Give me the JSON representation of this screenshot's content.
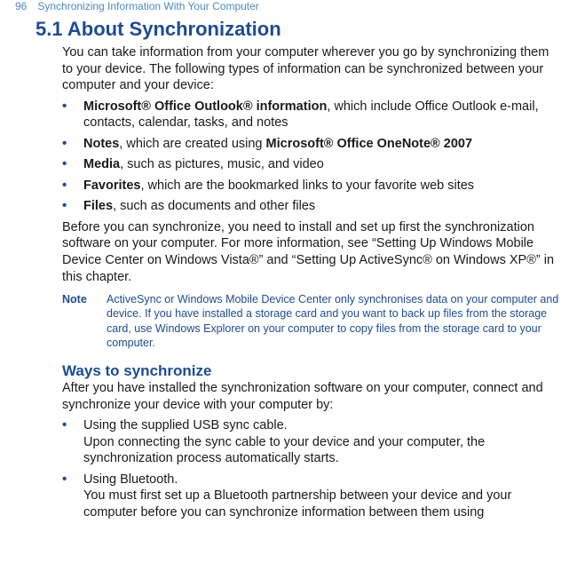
{
  "header": {
    "page_number": "96",
    "running_title": "Synchronizing Information With Your Computer"
  },
  "section": {
    "number": "5.1",
    "title": "About Synchronization"
  },
  "intro": "You can take information from your computer wherever you go by synchronizing them to your device. The following types of information can be synchronized between your computer and your device:",
  "bullets": [
    {
      "b": "Microsoft® Office Outlook® information",
      "after": ", which include Office Outlook e-mail, contacts, calendar, tasks, and notes"
    },
    {
      "b": "Notes",
      "mid": ", which are created using ",
      "b2": "Microsoft® Office OneNote® 2007"
    },
    {
      "b": "Media",
      "after": ", such as pictures, music, and video"
    },
    {
      "b": "Favorites",
      "after": ", which are the bookmarked links to your favorite web sites"
    },
    {
      "b": "Files",
      "after": ", such as documents and other files"
    }
  ],
  "para2": "Before you can synchronize, you need to install and set up first the synchronization software on your computer. For more information, see “Setting Up Windows Mobile Device Center on Windows Vista®” and “Setting Up ActiveSync® on Windows XP®” in this chapter.",
  "note": {
    "label": "Note",
    "text": "ActiveSync or Windows Mobile Device Center only synchronises data on your computer and device. If you have installed a storage card and you want to back up files from the storage card, use Windows Explorer on your computer to copy files from the storage card to your computer."
  },
  "subheading": "Ways to synchronize",
  "para3": "After you have installed the synchronization software on your computer, connect and synchronize your device with your computer by:",
  "bullets2": [
    {
      "line1": "Using the supplied USB sync cable.",
      "line2": "Upon connecting the sync cable to your device and your computer, the synchronization process automatically starts."
    },
    {
      "line1": "Using Bluetooth.",
      "line2": "You must first set up a Bluetooth partnership between your device and your computer before you can synchronize information between them using"
    }
  ]
}
